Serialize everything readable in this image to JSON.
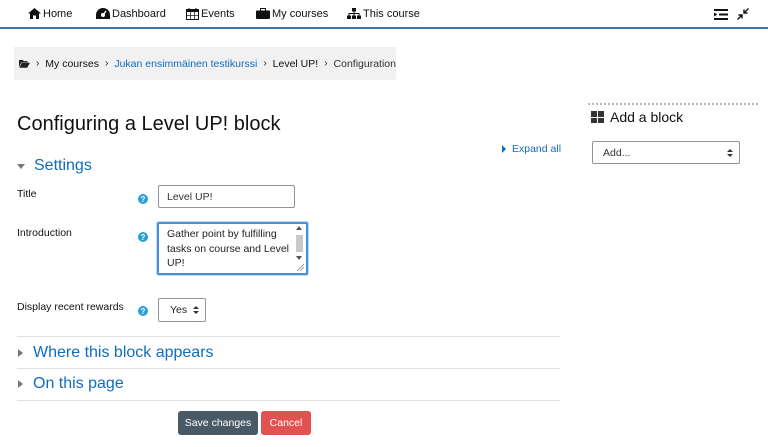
{
  "nav": {
    "home": "Home",
    "dashboard": "Dashboard",
    "events": "Events",
    "my_courses": "My courses",
    "this_course": "This course"
  },
  "breadcrumb": {
    "items": [
      "My courses",
      "Jukan ensimmäinen testikurssi",
      "Level UP!",
      "Configuration"
    ]
  },
  "page": {
    "title": "Configuring a Level UP! block",
    "expand_all": "Expand all"
  },
  "settings": {
    "section_label": "Settings",
    "fields": {
      "title_label": "Title",
      "title_value": "Level UP!",
      "intro_label": "Introduction",
      "intro_value": "Gather point by fulfilling tasks on course and Level UP!",
      "recent_label": "Display recent rewards",
      "recent_value": "Yes"
    }
  },
  "sections": {
    "where": "Where this block appears",
    "on_page": "On this page"
  },
  "buttons": {
    "save": "Save changes",
    "cancel": "Cancel"
  },
  "sidebar": {
    "add_block_title": "Add a block",
    "add_select_value": "Add..."
  },
  "colors": {
    "accent": "#0f6cbf",
    "nav_border": "#3e73a7",
    "save_button": "#495a66",
    "cancel_button": "#e35252",
    "help_icon": "#2a9fd6"
  }
}
